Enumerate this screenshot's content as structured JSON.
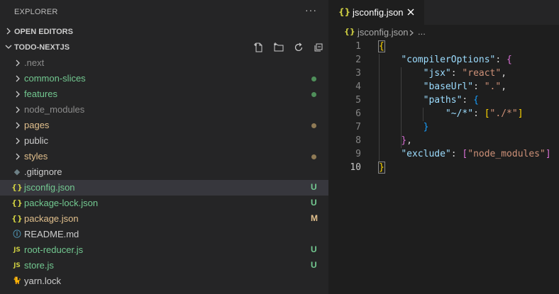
{
  "explorer": {
    "title": "EXPLORER",
    "more_icon": "ellipsis-icon",
    "sections": {
      "open_editors": "OPEN EDITORS",
      "project": "TODO-NEXTJS"
    },
    "project_actions": [
      "new-file-icon",
      "new-folder-icon",
      "refresh-icon",
      "collapse-all-icon"
    ],
    "tree": [
      {
        "name": ".next",
        "type": "folder",
        "color": "#8b8b8b"
      },
      {
        "name": "common-slices",
        "type": "folder",
        "color": "#73c991",
        "dot": "#4f8f5a"
      },
      {
        "name": "features",
        "type": "folder",
        "color": "#73c991",
        "dot": "#4f8f5a"
      },
      {
        "name": "node_modules",
        "type": "folder",
        "color": "#8b8b8b"
      },
      {
        "name": "pages",
        "type": "folder",
        "color": "#e2c08d",
        "dot": "#8f7a55"
      },
      {
        "name": "public",
        "type": "folder",
        "color": "#cccccc"
      },
      {
        "name": "styles",
        "type": "folder",
        "color": "#e2c08d",
        "dot": "#8f7a55"
      },
      {
        "name": ".gitignore",
        "type": "file",
        "icon": "gitignore-icon",
        "color": "#cccccc"
      },
      {
        "name": "jsconfig.json",
        "type": "file",
        "icon": "json-icon",
        "color": "#73c991",
        "badge": "U",
        "selected": true
      },
      {
        "name": "package-lock.json",
        "type": "file",
        "icon": "json-icon",
        "color": "#73c991",
        "badge": "U"
      },
      {
        "name": "package.json",
        "type": "file",
        "icon": "json-icon",
        "color": "#e2c08d",
        "badge": "M"
      },
      {
        "name": "README.md",
        "type": "file",
        "icon": "info-icon",
        "color": "#cccccc"
      },
      {
        "name": "root-reducer.js",
        "type": "file",
        "icon": "js-icon",
        "color": "#73c991",
        "badge": "U"
      },
      {
        "name": "store.js",
        "type": "file",
        "icon": "js-icon",
        "color": "#73c991",
        "badge": "U"
      },
      {
        "name": "yarn.lock",
        "type": "file",
        "icon": "yarn-icon",
        "color": "#cccccc"
      }
    ]
  },
  "editor": {
    "tab": {
      "label": "jsconfig.json",
      "icon": "{}"
    },
    "breadcrumb": {
      "file": "jsconfig.json",
      "more": "..."
    },
    "lines": [
      {
        "n": "1",
        "tokens": [
          [
            "{",
            "b1 bm"
          ]
        ]
      },
      {
        "n": "2",
        "tokens": [
          [
            "    ",
            "p"
          ],
          [
            "\"compilerOptions\"",
            "k"
          ],
          [
            ": ",
            "p"
          ],
          [
            "{",
            "b2"
          ]
        ]
      },
      {
        "n": "3",
        "tokens": [
          [
            "        ",
            "p"
          ],
          [
            "\"jsx\"",
            "k"
          ],
          [
            ": ",
            "p"
          ],
          [
            "\"react\"",
            "s"
          ],
          [
            ",",
            "p"
          ]
        ]
      },
      {
        "n": "4",
        "tokens": [
          [
            "        ",
            "p"
          ],
          [
            "\"baseUrl\"",
            "k"
          ],
          [
            ": ",
            "p"
          ],
          [
            "\".\"",
            "s"
          ],
          [
            ",",
            "p"
          ]
        ]
      },
      {
        "n": "5",
        "tokens": [
          [
            "        ",
            "p"
          ],
          [
            "\"paths\"",
            "k"
          ],
          [
            ": ",
            "p"
          ],
          [
            "{",
            "b3"
          ]
        ]
      },
      {
        "n": "6",
        "tokens": [
          [
            "            ",
            "p"
          ],
          [
            "\"~/*\"",
            "k"
          ],
          [
            ": ",
            "p"
          ],
          [
            "[",
            "b1"
          ],
          [
            "\"./*\"",
            "s"
          ],
          [
            "]",
            "b1"
          ]
        ]
      },
      {
        "n": "7",
        "tokens": [
          [
            "        ",
            "p"
          ],
          [
            "}",
            "b3"
          ]
        ]
      },
      {
        "n": "8",
        "tokens": [
          [
            "    ",
            "p"
          ],
          [
            "}",
            "b2"
          ],
          [
            ",",
            "p"
          ]
        ]
      },
      {
        "n": "9",
        "tokens": [
          [
            "    ",
            "p"
          ],
          [
            "\"exclude\"",
            "k"
          ],
          [
            ": ",
            "p"
          ],
          [
            "[",
            "b2"
          ],
          [
            "\"node_modules\"",
            "s"
          ],
          [
            "]",
            "b2"
          ]
        ]
      },
      {
        "n": "10",
        "tokens": [
          [
            "}",
            "b1 bm"
          ]
        ],
        "active": true
      }
    ]
  }
}
